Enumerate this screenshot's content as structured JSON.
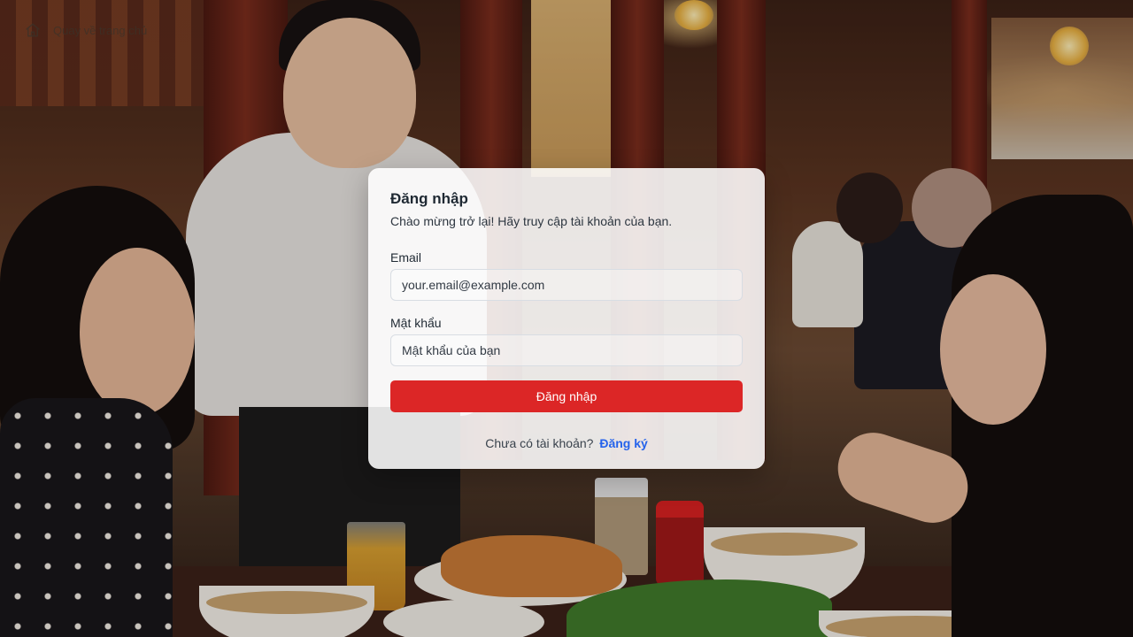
{
  "nav": {
    "back_label": "Quay về trang chủ",
    "back_icon": "home-icon"
  },
  "login": {
    "title": "Đăng nhập",
    "subtitle": "Chào mừng trở lại! Hãy truy cập tài khoản của bạn.",
    "email_label": "Email",
    "email_placeholder": "your.email@example.com",
    "password_label": "Mật khẩu",
    "password_placeholder": "Mật khẩu của bạn",
    "submit_label": "Đăng nhập",
    "no_account_text": "Chưa có tài khoản?",
    "signup_link": "Đăng ký"
  },
  "colors": {
    "primary_button": "#dc2626",
    "link": "#2563eb",
    "card_background": "rgba(255,255,255,0.88)"
  }
}
